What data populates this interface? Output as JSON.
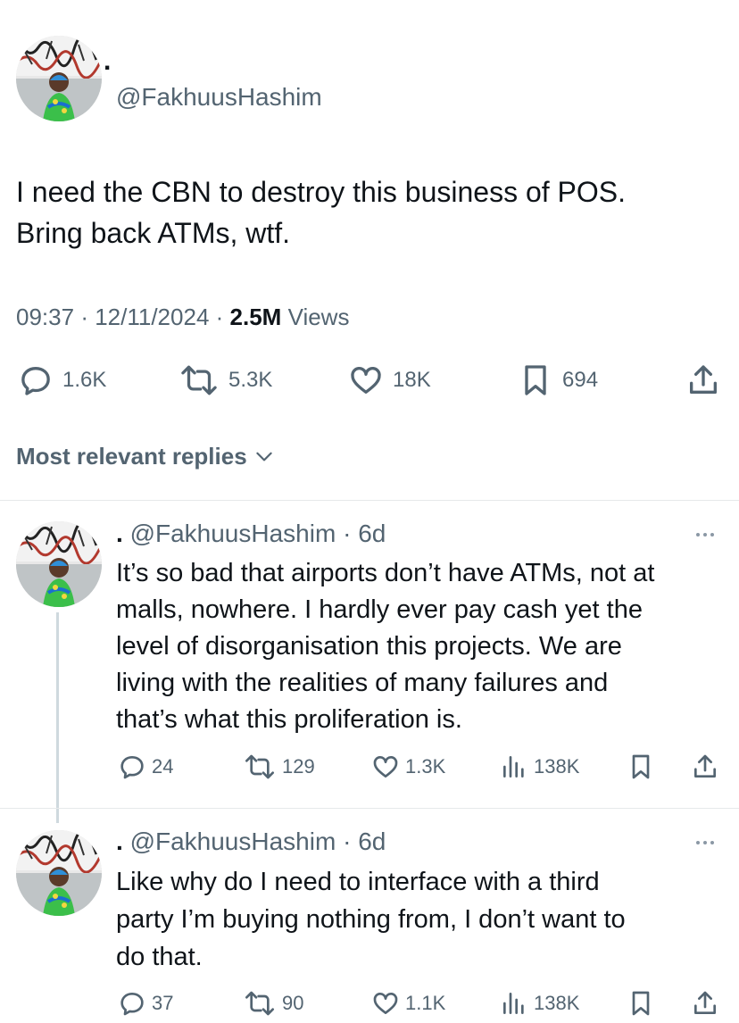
{
  "main_tweet": {
    "display_name": ".",
    "handle": "@FakhuusHashim",
    "text_line1": "I need the CBN to destroy this business of POS.",
    "text_line2": "Bring back ATMs, wtf.",
    "time": "09:37",
    "date": "12/11/2024",
    "views_count": "2.5M",
    "views_label": "Views",
    "stats": {
      "replies": "1.6K",
      "reposts": "5.3K",
      "likes": "18K",
      "bookmarks": "694"
    }
  },
  "replies_filter": {
    "label": "Most relevant replies"
  },
  "replies": [
    {
      "display_name": ".",
      "handle": "@FakhuusHashim",
      "age": "6d",
      "lines": [
        "It’s so bad that airports don’t have ATMs, not at",
        "malls, nowhere. I hardly ever pay cash yet the",
        "level of disorganisation this projects. We are",
        "living with the realities of many failures and",
        "that’s what this proliferation is."
      ],
      "stats": {
        "replies": "24",
        "reposts": "129",
        "likes": "1.3K",
        "views": "138K"
      }
    },
    {
      "display_name": ".",
      "handle": "@FakhuusHashim",
      "age": "6d",
      "lines": [
        "Like why do I need to interface with a third",
        "party I’m buying nothing from, I don’t want to",
        "do that."
      ],
      "stats": {
        "replies": "37",
        "reposts": "90",
        "likes": "1.1K",
        "views": "138K"
      }
    }
  ],
  "colors": {
    "text": "#0f1419",
    "muted": "#536471",
    "divider": "#e6e9ea",
    "thread_line": "#cfd9de"
  },
  "icons": [
    "reply-icon",
    "repost-icon",
    "like-icon",
    "bookmark-icon",
    "share-icon",
    "views-icon",
    "more-icon",
    "chevron-down-icon"
  ]
}
